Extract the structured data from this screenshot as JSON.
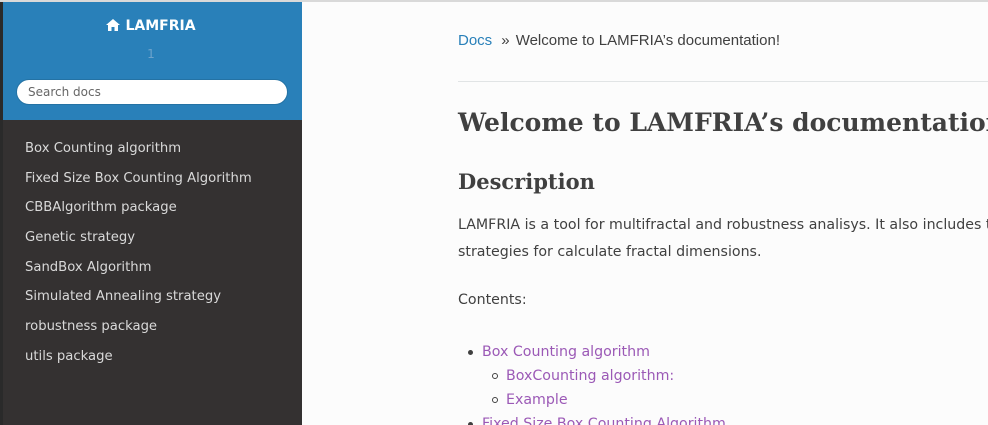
{
  "sidebar": {
    "brand": "LAMFRIA",
    "version": "1",
    "search_placeholder": "Search docs",
    "items": [
      {
        "label": "Box Counting algorithm"
      },
      {
        "label": "Fixed Size Box Counting Algorithm"
      },
      {
        "label": "CBBAlgorithm package"
      },
      {
        "label": "Genetic strategy"
      },
      {
        "label": "SandBox Algorithm"
      },
      {
        "label": "Simulated Annealing strategy"
      },
      {
        "label": "robustness package"
      },
      {
        "label": "utils package"
      }
    ]
  },
  "breadcrumb": {
    "root": "Docs",
    "separator": "»",
    "current": "Welcome to LAMFRIA’s documentation!"
  },
  "content": {
    "title": "Welcome to LAMFRIA’s documentation!",
    "section_heading": "Description",
    "paragraph_line1": "LAMFRIA is a tool for multifractal and robustness analisys. It also includes t",
    "paragraph_line2": "strategies for calculate fractal dimensions.",
    "contents_label": "Contents:",
    "toc": [
      {
        "label": "Box Counting algorithm",
        "level": 1
      },
      {
        "label": "BoxCounting algorithm:",
        "level": 2
      },
      {
        "label": "Example",
        "level": 2
      },
      {
        "label": "Fixed Size Box Counting Algorithm",
        "level": 1
      }
    ]
  },
  "colors": {
    "sidebar_header": "#2980b9",
    "sidebar_bg": "#343131",
    "link": "#2980b9",
    "visited_link": "#9b59b6",
    "text": "#404040"
  }
}
